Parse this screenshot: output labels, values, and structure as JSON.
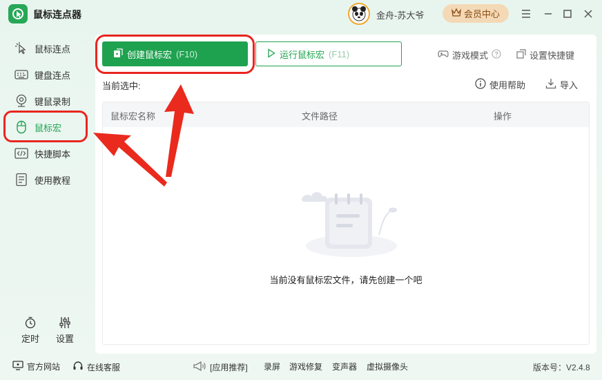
{
  "app": {
    "title": "鼠标连点器"
  },
  "user": {
    "name": "金舟-苏大爷",
    "vip_label": "会员中心"
  },
  "sidebar": {
    "items": [
      {
        "label": "鼠标连点",
        "icon": "cursor-click-icon"
      },
      {
        "label": "键盘连点",
        "icon": "keyboard-icon"
      },
      {
        "label": "键鼠录制",
        "icon": "record-icon"
      },
      {
        "label": "鼠标宏",
        "icon": "mouse-icon",
        "active": true
      },
      {
        "label": "快捷脚本",
        "icon": "code-icon"
      },
      {
        "label": "使用教程",
        "icon": "document-icon"
      }
    ],
    "timer_label": "定时",
    "settings_label": "设置"
  },
  "toolbar": {
    "create_label": "创建鼠标宏",
    "create_key": "(F10)",
    "run_label": "运行鼠标宏",
    "run_key": "(F11)",
    "game_mode": "游戏模式",
    "shortcut_settings": "设置快捷键",
    "help": "使用帮助",
    "import": "导入"
  },
  "current_selection_label": "当前选中:",
  "table": {
    "columns": [
      "鼠标宏名称",
      "文件路径",
      "操作"
    ],
    "empty_text": "当前没有鼠标宏文件，请先创建一个吧"
  },
  "footer": {
    "website": "官方网站",
    "support": "在线客服",
    "recommend": "[应用推荐]",
    "links": [
      "录屏",
      "游戏修复",
      "变声器",
      "虚拟摄像头"
    ],
    "version": "版本号：V2.4.8"
  },
  "colors": {
    "accent": "#1fa24f",
    "highlight": "#e8251e",
    "vip": "#f4d9b7"
  }
}
